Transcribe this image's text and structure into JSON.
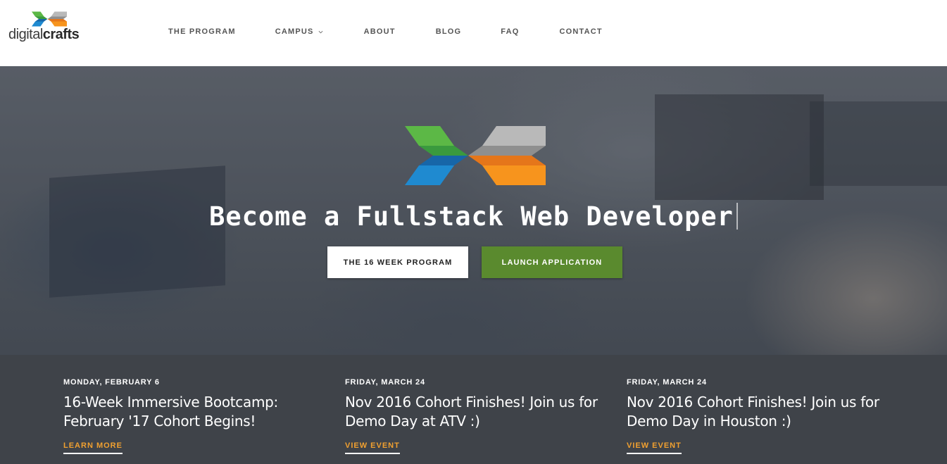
{
  "brand": {
    "name_light": "digital",
    "name_bold": "crafts"
  },
  "nav": {
    "items": [
      {
        "label": "THE PROGRAM",
        "has_dropdown": false
      },
      {
        "label": "CAMPUS",
        "has_dropdown": true
      },
      {
        "label": "ABOUT",
        "has_dropdown": false
      },
      {
        "label": "BLOG",
        "has_dropdown": false
      },
      {
        "label": "FAQ",
        "has_dropdown": false
      },
      {
        "label": "CONTACT",
        "has_dropdown": false
      }
    ]
  },
  "hero": {
    "title": "Become a Fullstack Web Developer",
    "primary_button": "THE 16 WEEK PROGRAM",
    "secondary_button": "LAUNCH APPLICATION"
  },
  "events": [
    {
      "date": "MONDAY, FEBRUARY 6",
      "title": "16-Week Immersive Bootcamp: February '17 Cohort Begins!",
      "link": "LEARN MORE"
    },
    {
      "date": "FRIDAY, MARCH 24",
      "title": "Nov 2016 Cohort Finishes! Join us for Demo Day at ATV :)",
      "link": "VIEW EVENT"
    },
    {
      "date": "FRIDAY, MARCH 24",
      "title": "Nov 2016 Cohort Finishes! Join us for Demo Day in Houston :)",
      "link": "VIEW EVENT"
    }
  ],
  "colors": {
    "accent_green": "#5a8a2e",
    "link_orange": "#f0a030",
    "logo_green": "#5cb846",
    "logo_blue": "#1f8ad0",
    "logo_gray": "#a9a9a9",
    "logo_orange": "#f7941d"
  },
  "icons": {
    "logo": "digitalcrafts-logo-mark",
    "dropdown": "chevron-down-icon"
  }
}
